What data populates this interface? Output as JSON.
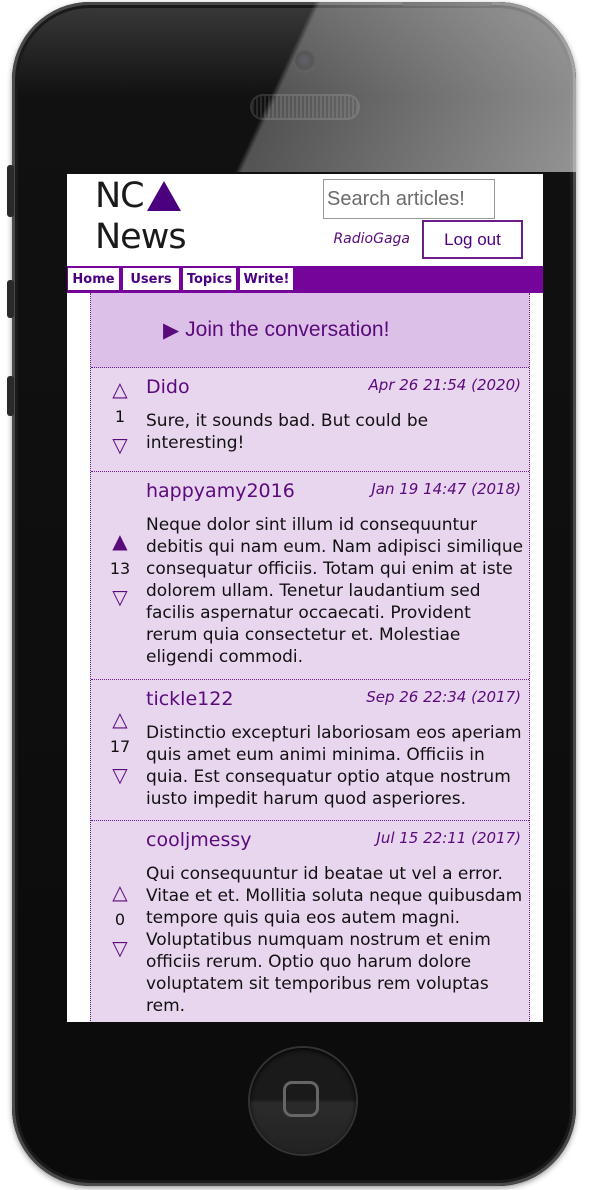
{
  "app": {
    "logo_line1": "NC",
    "logo_line2": "News"
  },
  "header": {
    "search_placeholder": "Search articles!",
    "username": "RadioGaga",
    "logout_label": "Log out"
  },
  "nav": {
    "items": [
      {
        "label": "Home"
      },
      {
        "label": "Users"
      },
      {
        "label": "Topics"
      },
      {
        "label": "Write!"
      }
    ]
  },
  "join": {
    "arrow": "▶",
    "label": "Join the conversation!"
  },
  "comments": [
    {
      "author": "Dido",
      "date": "Apr 26 21:54 (2020)",
      "votes": "1",
      "upvoted": false,
      "body": "Sure, it sounds bad. But could be interesting!"
    },
    {
      "author": "happyamy2016",
      "date": "Jan 19 14:47 (2018)",
      "votes": "13",
      "upvoted": true,
      "body": "Neque dolor sint illum id consequuntur debitis qui nam eum. Nam adipisci similique consequatur officiis. Totam qui enim at iste dolorem ullam. Tenetur laudantium sed facilis aspernatur occaecati. Provident rerum quia consectetur et. Molestiae eligendi commodi."
    },
    {
      "author": "tickle122",
      "date": "Sep 26 22:34 (2017)",
      "votes": "17",
      "upvoted": false,
      "body": "Distinctio excepturi laboriosam eos aperiam quis amet eum animi minima. Officiis in quia. Est consequatur optio atque nostrum iusto impedit harum quod asperiores."
    },
    {
      "author": "cooljmessy",
      "date": "Jul 15 22:11 (2017)",
      "votes": "0",
      "upvoted": false,
      "body": "Qui consequuntur id beatae ut vel a error. Vitae et et. Mollitia soluta neque quibusdam tempore quis quia eos autem magni. Voluptatibus numquam nostrum et enim officiis rerum. Optio quo harum dolore voluptatem sit temporibus rem voluptas rem."
    }
  ],
  "icons": {
    "upvote": "upvote-triangle-icon",
    "downvote": "downvote-triangle-icon"
  },
  "colors": {
    "accent": "#75049b",
    "text_accent": "#5a0a7a",
    "content_bg": "#e8d5ee",
    "join_bg": "#dcc0e8"
  }
}
